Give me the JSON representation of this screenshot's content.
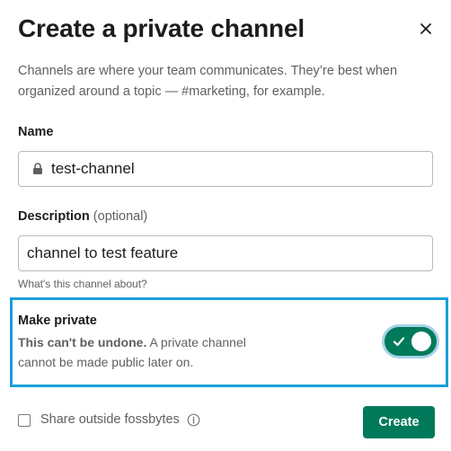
{
  "dialog": {
    "title": "Create a private channel",
    "intro": "Channels are where your team communicates. They’re best when organized around a topic — #marketing, for example."
  },
  "name_field": {
    "label": "Name",
    "value": "test-channel",
    "icon": "lock-icon"
  },
  "description_field": {
    "label": "Description",
    "optional_label": "(optional)",
    "value": "channel to test feature",
    "hint": "What's this channel about?"
  },
  "make_private": {
    "title": "Make private",
    "warning_bold": "This can't be undone.",
    "warning_rest": " A private channel cannot be made public later on.",
    "enabled": true
  },
  "share_outside": {
    "label": "Share outside fossbytes",
    "checked": false
  },
  "create_button": {
    "label": "Create"
  },
  "colors": {
    "accent_green": "#007a5a",
    "highlight_blue": "#1a9fd8"
  }
}
